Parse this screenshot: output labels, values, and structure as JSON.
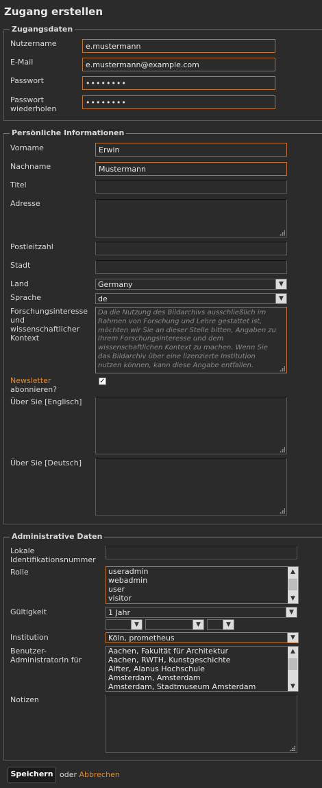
{
  "page": {
    "title": "Zugang erstellen"
  },
  "account": {
    "legend": "Zugangsdaten",
    "username_label": "Nutzername",
    "username_value": "e.mustermann",
    "email_label": "E-Mail",
    "email_value": "e.mustermann@example.com",
    "password_label": "Passwort",
    "password_value": "••••••••",
    "password_repeat_label_1": "Passwort",
    "password_repeat_label_2": "wiederholen",
    "password_repeat_value": "••••••••"
  },
  "personal": {
    "legend": "Persönliche Informationen",
    "firstname_label": "Vorname",
    "firstname_value": "Erwin",
    "lastname_label": "Nachname",
    "lastname_value": "Mustermann",
    "title_label": "Titel",
    "address_label": "Adresse",
    "zip_label": "Postleitzahl",
    "city_label": "Stadt",
    "country_label": "Land",
    "country_value": "Germany",
    "language_label": "Sprache",
    "language_value": "de",
    "research_label_1": "Forschungsinteresse",
    "research_label_2": "und",
    "research_label_3": "wissenschaftlicher",
    "research_label_4": "Kontext",
    "research_placeholder": "Da die Nutzung des Bildarchivs ausschließlich im Rahmen von Forschung und Lehre gestattet ist, möchten wir Sie an dieser Stelle bitten, Angaben zu Ihrem Forschungsinteresse und dem wissenschaftlichen Kontext zu machen. Wenn Sie das Bildarchiv über eine lizenzierte Institution nutzen können, kann diese Angabe entfallen.",
    "newsletter_label_1": "Newsletter",
    "newsletter_label_2": "abonnieren?",
    "newsletter_checked": "✓",
    "about_en_label": "Über Sie [Englisch]",
    "about_de_label": "Über Sie [Deutsch]"
  },
  "admin": {
    "legend": "Administrative Daten",
    "local_id_label_1": "Lokale",
    "local_id_label_2": "Identifikationsnummer",
    "role_label": "Rolle",
    "roles": [
      "useradmin",
      "webadmin",
      "user",
      "visitor"
    ],
    "validity_label": "Gültigkeit",
    "validity_value": "1 Jahr",
    "institution_label": "Institution",
    "institution_value": "Köln, prometheus",
    "useradmin_label_1": "Benutzer-",
    "useradmin_label_2": "AdministratorIn für",
    "useradmin_options": [
      "Aachen, Fakultät für Architektur",
      "Aachen, RWTH, Kunstgeschichte",
      "Alfter, Alanus Hochschule",
      "Amsterdam, Amsterdam",
      "Amsterdam, Stadtmuseum Amsterdam"
    ],
    "notes_label": "Notizen"
  },
  "actions": {
    "save_label": "Speichern",
    "or_text": "oder",
    "cancel_label": "Abbrechen"
  },
  "icons": {
    "dropdown": "chevron-down-icon",
    "scroll_up": "chevron-up-icon",
    "resize": "resize-grip-icon",
    "check": "check-icon"
  },
  "colors": {
    "accent": "#e08a2c",
    "background": "#2b2b2b"
  }
}
